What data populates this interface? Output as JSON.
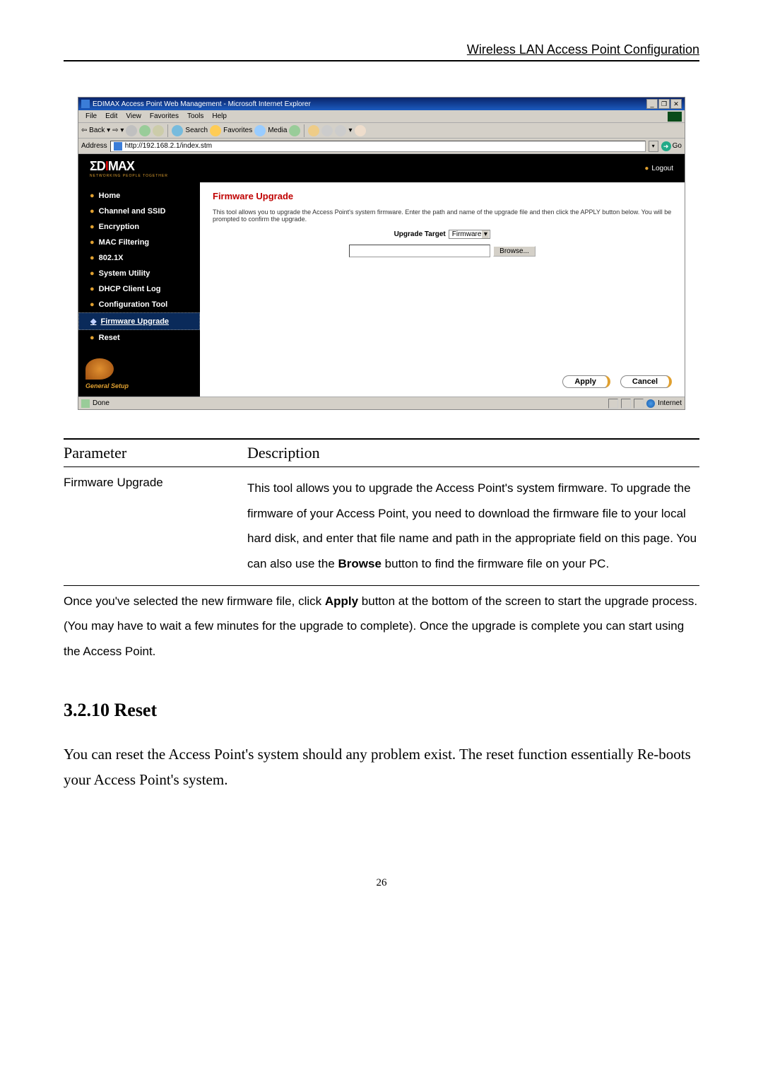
{
  "header": {
    "title": "Wireless LAN Access Point Configuration"
  },
  "browser": {
    "titlebar": "EDIMAX Access Point Web Management - Microsoft Internet Explorer",
    "window_buttons": {
      "min": "_",
      "max": "❐",
      "close": "✕"
    },
    "menu": [
      "File",
      "Edit",
      "View",
      "Favorites",
      "Tools",
      "Help"
    ],
    "toolbar": {
      "back": "Back",
      "search": "Search",
      "favorites": "Favorites",
      "media": "Media"
    },
    "address_label": "Address",
    "address_value": "http://192.168.2.1/index.stm",
    "go": "Go",
    "logo": {
      "pre": "ΣD",
      "mid": "I",
      "post": "MAX",
      "sub": "NETWORKING PEOPLE TOGETHER"
    },
    "logout": "Logout",
    "nav": [
      {
        "label": "Home"
      },
      {
        "label": "Channel and SSID"
      },
      {
        "label": "Encryption"
      },
      {
        "label": "MAC Filtering"
      },
      {
        "label": "802.1X"
      },
      {
        "label": "System Utility"
      },
      {
        "label": "DHCP Client Log"
      },
      {
        "label": "Configuration Tool"
      },
      {
        "label": "Firmware Upgrade",
        "active": true
      },
      {
        "label": "Reset"
      }
    ],
    "general_setup": "General Setup",
    "panel": {
      "title": "Firmware Upgrade",
      "desc": "This tool allows you to upgrade the Access Point's system firmware. Enter the path and name of the upgrade file and then click the APPLY button below. You will be prompted to confirm the upgrade.",
      "upgrade_target_label": "Upgrade Target",
      "upgrade_target_value": "Firmware",
      "browse": "Browse...",
      "apply": "Apply",
      "cancel": "Cancel"
    },
    "status": {
      "done": "Done",
      "zone": "Internet"
    }
  },
  "table": {
    "h1": "Parameter",
    "h2": "Description",
    "row_param": "Firmware Upgrade",
    "row_desc_1": "This tool allows you to upgrade the Access Point's system firmware. To upgrade the firmware of your Access Point, you need to download the firmware file to your local hard disk, and enter that file name and path in the appropriate field on this page. You can also use the ",
    "row_desc_bold": "Browse",
    "row_desc_2": " button to find the firmware file on your PC."
  },
  "after_1": "Once you've selected the new firmware file, click ",
  "after_bold": "Apply",
  "after_2": " button at the bottom of the screen to start the upgrade process. (You may have to wait a few minutes for the upgrade to complete). Once the upgrade is complete you can start using the Access Point.",
  "section": {
    "heading": "3.2.10 Reset",
    "body": "You can reset the Access Point's system should any problem exist. The reset function essentially Re-boots your Access Point's system."
  },
  "page_number": "26"
}
